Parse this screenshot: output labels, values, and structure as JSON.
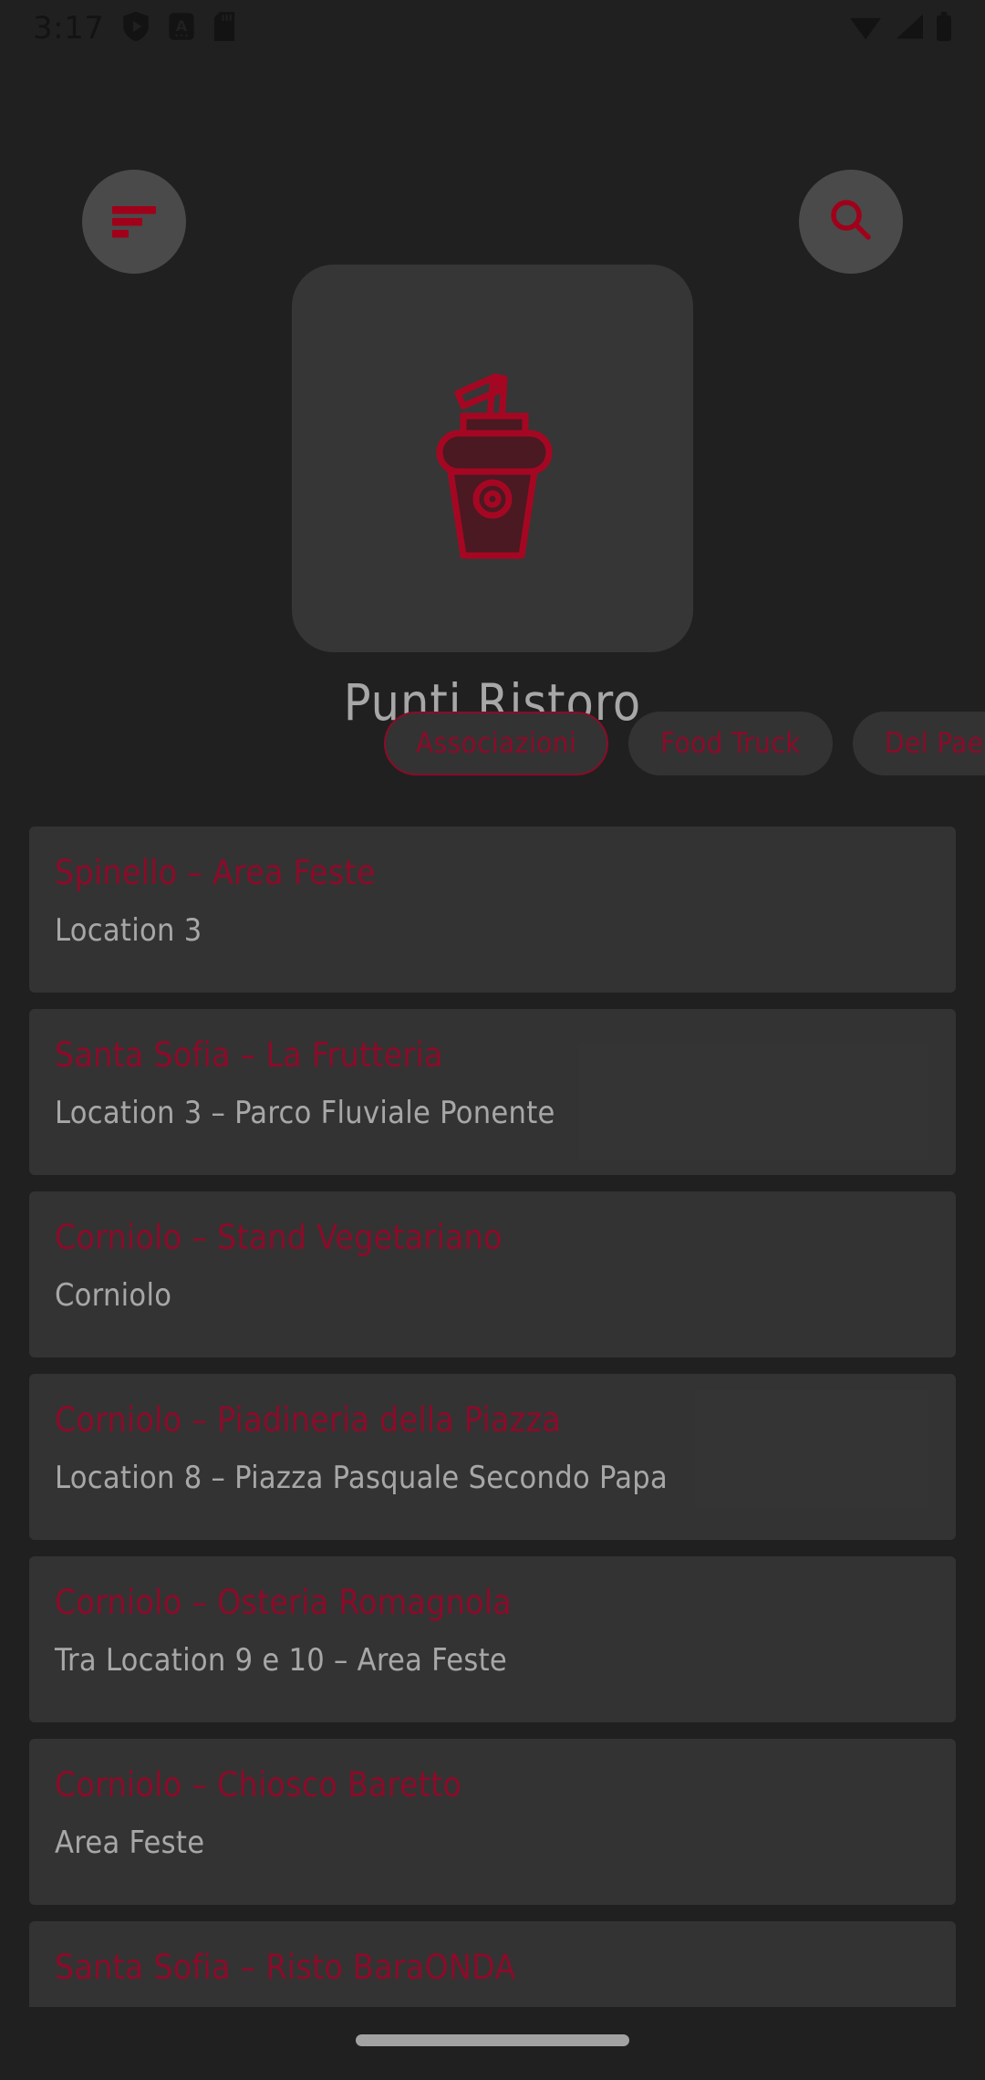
{
  "statusbar": {
    "time": "3:17",
    "left_icons": [
      "shield-play-icon",
      "font-a-icon",
      "sd-card-icon"
    ],
    "right_icons": [
      "wifi-icon",
      "cellular-signal-icon",
      "battery-icon"
    ]
  },
  "header": {
    "filter_button": "filter-icon",
    "search_button": "search-icon",
    "app_icon": "drink-cup-icon",
    "title": "Punti Ristoro"
  },
  "chips": [
    {
      "label": "Associazioni",
      "selected": true
    },
    {
      "label": "Food Truck",
      "selected": false
    },
    {
      "label": "Del Paese",
      "selected": false
    }
  ],
  "list": [
    {
      "title": "Spinello – Area Feste",
      "subtitle": "Location 3"
    },
    {
      "title": "Santa Sofia – La Frutteria",
      "subtitle": "Location 3 – Parco Fluviale Ponente"
    },
    {
      "title": "Corniolo – Stand Vegetariano",
      "subtitle": "Corniolo"
    },
    {
      "title": "Corniolo – Piadineria della Piazza",
      "subtitle": "Location 8 – Piazza Pasquale Secondo Papa"
    },
    {
      "title": "Corniolo – Osteria Romagnola",
      "subtitle": "Tra Location 9 e 10 – Area Feste"
    },
    {
      "title": "Corniolo – Chiosco Baretto",
      "subtitle": "Area Feste"
    },
    {
      "title": "Santa Sofia – Risto BaraONDA",
      "subtitle": ""
    }
  ],
  "colors": {
    "accent": "#c8103c",
    "background": "#2e2e2e",
    "card": "#4a4a4a",
    "icon_tile": "#4e4e4e",
    "text_primary": "#f0f0f0"
  }
}
